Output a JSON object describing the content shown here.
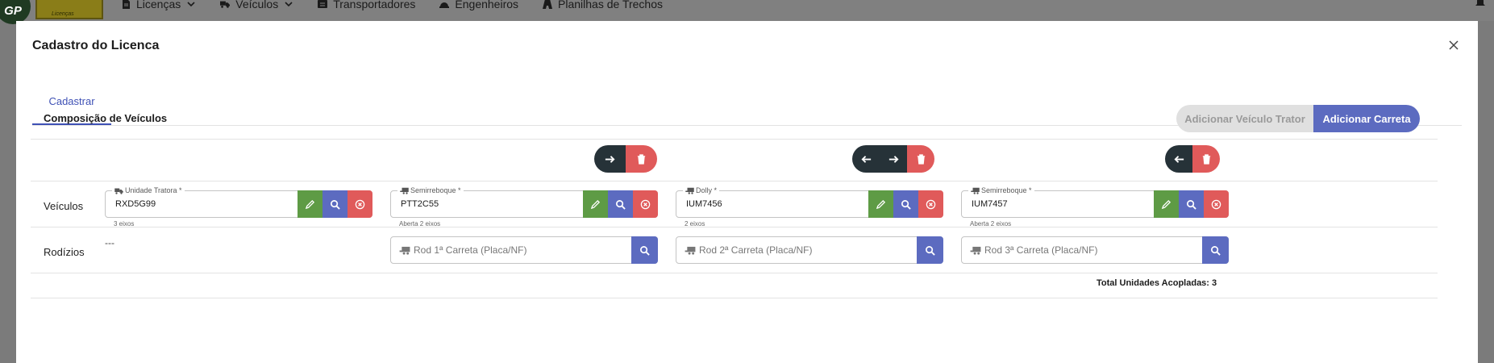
{
  "nav": {
    "logo_text": "GP",
    "logo_sub": "Licenças",
    "items": [
      {
        "label": "Licenças",
        "icon": "document-icon",
        "dropdown": true
      },
      {
        "label": "Veículos",
        "icon": "truck-icon",
        "dropdown": true
      },
      {
        "label": "Transportadores",
        "icon": "id-card-icon",
        "dropdown": false
      },
      {
        "label": "Engenheiros",
        "icon": "helmet-icon",
        "dropdown": false
      },
      {
        "label": "Planilhas de Trechos",
        "icon": "road-icon",
        "dropdown": false
      }
    ]
  },
  "modal": {
    "title": "Cadastro do Licenca",
    "tab": "Cadastrar",
    "section_title": "Composição de Veículos",
    "btn_trator": "Adicionar Veículo Trator",
    "btn_carreta": "Adicionar Carreta",
    "row_veiculos": "Veículos",
    "row_rodizios": "Rodízios",
    "no_rodizio": "---",
    "total_label": "Total Unidades Acopladas: 3"
  },
  "vehicles": [
    {
      "label": "Unidade Tratora *",
      "value": "RXD5G99",
      "hint": "3 eixos",
      "icon": "truck-icon"
    },
    {
      "label": "Semirreboque *",
      "value": "PTT2C55",
      "hint": "Aberta 2 eixos",
      "icon": "trailer-icon"
    },
    {
      "label": "Dolly *",
      "value": "IUM7456",
      "hint": "2 eixos",
      "icon": "trailer-icon"
    },
    {
      "label": "Semirreboque *",
      "value": "IUM7457",
      "hint": "Aberta 2 eixos",
      "icon": "trailer-icon"
    }
  ],
  "rodizios": [
    {
      "placeholder": "Rod 1ª Carreta (Placa/NF)"
    },
    {
      "placeholder": "Rod 2ª Carreta (Placa/NF)"
    },
    {
      "placeholder": "Rod 3ª Carreta (Placa/NF)"
    }
  ],
  "colors": {
    "primary": "#5c6bc0",
    "dark": "#263238",
    "danger": "#e05a5a",
    "success": "#5e9b45"
  }
}
